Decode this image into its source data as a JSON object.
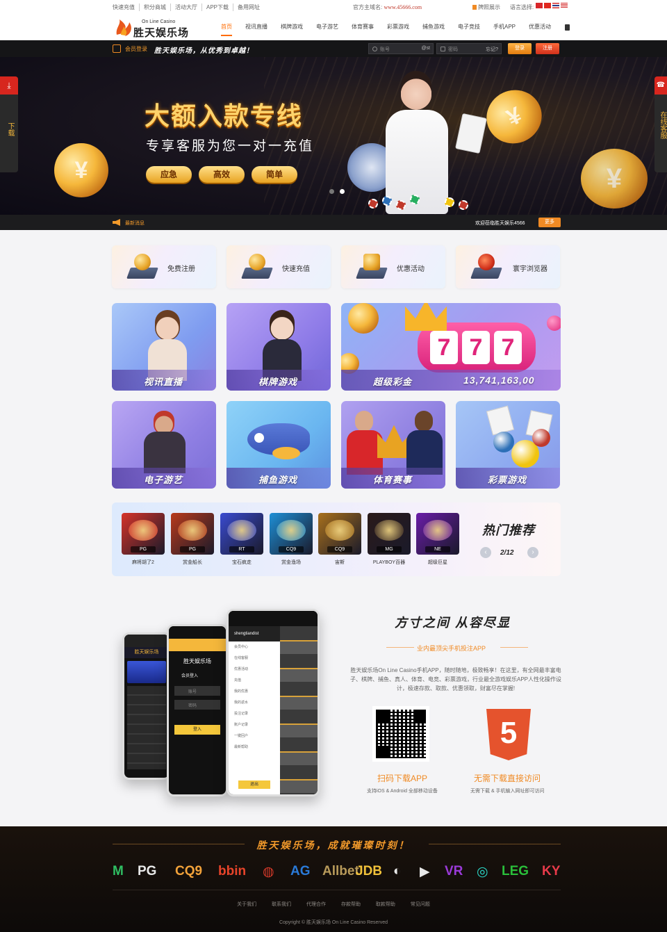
{
  "topbar": {
    "links": [
      "快速充值",
      "积分商城",
      "活动大厅",
      "APP下载",
      "备用网址"
    ],
    "domain_label": "官方主域名:",
    "domain_value": "www.45666.com",
    "rights_label": "牌照展示",
    "language_label": "语言选择:"
  },
  "header": {
    "logo_sub": "On Line Casino",
    "logo_main": "胜天娱乐场",
    "nav": [
      "首页",
      "视讯直播",
      "棋牌游戏",
      "电子游艺",
      "体育赛事",
      "彩票游戏",
      "捕鱼游戏",
      "电子竞技",
      "手机APP",
      "优惠活动"
    ]
  },
  "login": {
    "title": "会员登录",
    "slogan": "胜天娱乐场，从优秀到卓越！",
    "username_placeholder": "账号",
    "username_suffix": "@st",
    "password_placeholder": "密码",
    "forgot": "忘记?",
    "login_btn": "登录",
    "register_btn": "注册"
  },
  "banner": {
    "title": "大额入款专线",
    "subtitle": "专享客服为您一对一充值",
    "pills": [
      "应急",
      "高效",
      "简单"
    ],
    "side_left": "下载",
    "side_right": "在线客服"
  },
  "notice": {
    "label": "最新消息",
    "message": "欢迎莅临胜天娱乐4566",
    "more": "更多"
  },
  "quick_actions": [
    "免费注册",
    "快速充值",
    "优惠活动",
    "寰宇浏览器"
  ],
  "tiles": {
    "live": "视讯直播",
    "chess": "棋牌游戏",
    "jackpot": "超级彩金",
    "jackpot_amount": "13,741,163,00",
    "slots": "电子游艺",
    "fishing": "捕鱼游戏",
    "sports": "体育赛事",
    "lottery": "彩票游戏"
  },
  "hot": {
    "title": "热门推荐",
    "page": "2/12",
    "games": [
      {
        "name": "麻将胡了2",
        "provider": "PG",
        "color": "#d6342a"
      },
      {
        "name": "赏金船长",
        "provider": "PG",
        "color": "#b83a1c"
      },
      {
        "name": "宝石疯走",
        "provider": "RT",
        "color": "#3a4bd0"
      },
      {
        "name": "赏金渔场",
        "provider": "CQ9",
        "color": "#1e8fd6"
      },
      {
        "name": "宙斯",
        "provider": "CQ9",
        "color": "#a8701c"
      },
      {
        "name": "PLAYBOY百器",
        "provider": "MG",
        "color": "#2a1a1a"
      },
      {
        "name": "超级巨星",
        "provider": "NE",
        "color": "#6a1ca8"
      }
    ]
  },
  "app": {
    "title": "方寸之间  从容尽显",
    "subtitle": "业内最顶尖手机投注APP",
    "desc": "胜天娱乐场On Line Casino手机APP，随时随地，极致畅享！在这里，有全网最丰富电子、棋牌、捕鱼、真人、体育、电竞、彩票游戏，行业最全游戏娱乐APP人性化操作设计，极速存款、取款、优惠领取，财富尽在掌握!",
    "qr_title": "扫码下载APP",
    "qr_desc": "支持iOS & Android 全部移动设备",
    "h5_title": "无需下载直接访问",
    "h5_desc": "无需下载 & 手机输入网址即可访问",
    "phone1_header": "胜天娱乐场",
    "phone2_header": "会员登入",
    "phone2_user": "账号",
    "phone2_pass": "密码",
    "phone2_btn": "登入",
    "phone3_user": "shengtiandist",
    "phone3_menu": [
      "会员中心",
      "在线客服",
      "优惠活动",
      "充值",
      "我的优惠",
      "我的返水",
      "投注记录",
      "账户记录",
      "一键回户",
      "最新帮助"
    ],
    "phone3_btn": "退出"
  },
  "footer": {
    "slogan": "胜天娱乐场，成就璀璨时刻！",
    "providers": [
      {
        "name": "M",
        "color": "#2fbf63"
      },
      {
        "name": "PG",
        "color": "#e8e8e8"
      },
      {
        "name": "CQ9",
        "color": "#f2a23a"
      },
      {
        "name": "bbin",
        "color": "#e8442a"
      },
      {
        "name": "◍",
        "color": "#d83a2a"
      },
      {
        "name": "AG",
        "color": "#2a7ad8"
      },
      {
        "name": "Allbet",
        "color": "#b89a5a"
      },
      {
        "name": "JDB",
        "color": "#f2c23a"
      },
      {
        "name": "◐",
        "color": "#e8e8e8"
      },
      {
        "name": "▶",
        "color": "#e8e8e8"
      },
      {
        "name": "VR",
        "color": "#9a3ad8"
      },
      {
        "name": "◎",
        "color": "#2ad8c8"
      },
      {
        "name": "LEG",
        "color": "#2abf3a"
      },
      {
        "name": "KY",
        "color": "#e83a4a"
      }
    ],
    "links": [
      "关于我们",
      "联系我们",
      "代理合作",
      "存款帮助",
      "取款帮助",
      "常见问题"
    ],
    "copyright": "Copyright © 胜天娱乐场 On Line Casino Reserved"
  }
}
